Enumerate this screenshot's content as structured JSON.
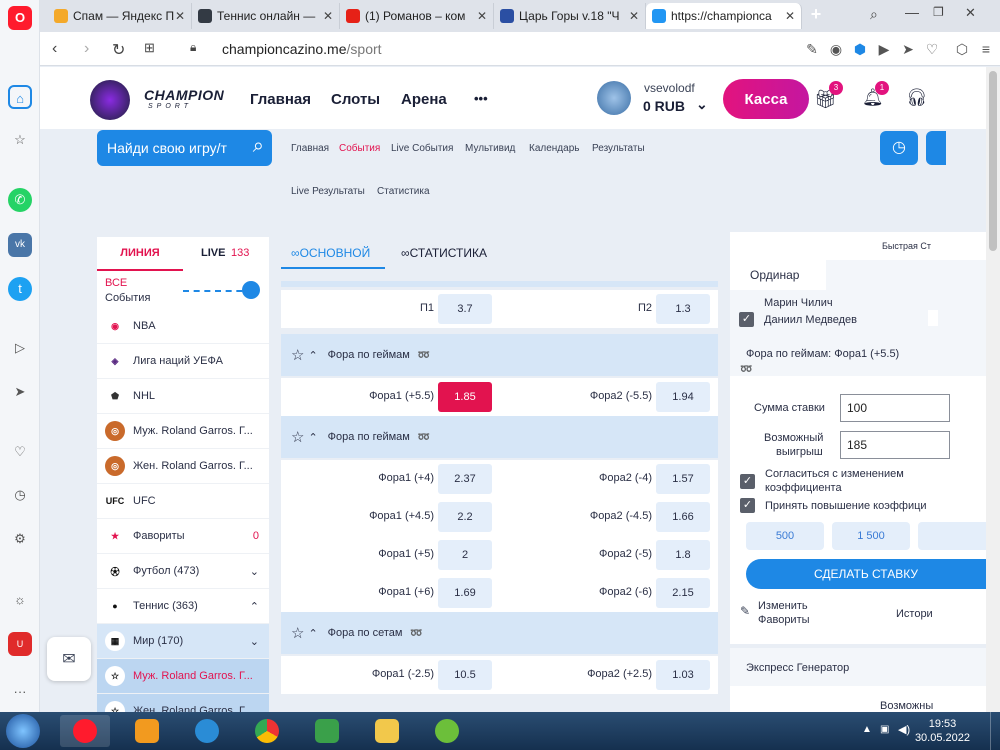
{
  "browser": {
    "tabs": [
      {
        "label": "Спам — Яндекс П",
        "color": "#f4a92a"
      },
      {
        "label": "Теннис онлайн —",
        "color": "#333a44"
      },
      {
        "label": "(1) Романов – ком",
        "color": "#e62117"
      },
      {
        "label": "Царь Горы v.18 \"Ч",
        "color": "#2b4fa3"
      },
      {
        "label": "https://championca",
        "color": "#2196f3"
      }
    ],
    "url_domain": "championcazino.me",
    "url_path": "/sport"
  },
  "header": {
    "logo_top": "CHAMPION",
    "logo_bottom": "SPORT",
    "nav": [
      "Главная",
      "Слоты",
      "Арена"
    ],
    "more_label": "•••",
    "username": "vsevolodf",
    "balance": "0 RUB",
    "kassa_label": "Касса",
    "gift_badge": "3",
    "bell_badge": "1"
  },
  "search": {
    "placeholder": "Найди свою игру/т"
  },
  "subnav": [
    "Главная",
    "События",
    "Live События",
    "Мультивид",
    "Календарь",
    "Результаты",
    "Live Результаты",
    "Статистика"
  ],
  "left": {
    "tab_line": "ЛИНИЯ",
    "tab_live": "LIVE",
    "live_count": "133",
    "all_label": "ВСЕ",
    "events_label": "События",
    "items": [
      {
        "label": "NBA",
        "right": ""
      },
      {
        "label": "Лига наций УЕФА",
        "right": ""
      },
      {
        "label": "NHL",
        "right": ""
      },
      {
        "label": "Муж. Roland Garros. Г...",
        "right": ""
      },
      {
        "label": "Жен. Roland Garros. Г...",
        "right": ""
      },
      {
        "label": "UFC",
        "right": ""
      },
      {
        "label": "Фавориты",
        "right": "0"
      },
      {
        "label": "Футбол (473)",
        "right": "⌄"
      },
      {
        "label": "Теннис (363)",
        "right": "⌃"
      },
      {
        "label": "Мир (170)",
        "right": "⌄"
      },
      {
        "label": "Муж. Roland Garros. Г...",
        "right": ""
      },
      {
        "label": "Жен. Roland Garros. Г...",
        "right": ""
      }
    ]
  },
  "center": {
    "tab_main": "ОСНОВНОЙ",
    "tab_stats": "СТАТИСТИКА",
    "rows": [
      {
        "type": "odds",
        "l1": "П1",
        "v1": "3.7",
        "l2": "П2",
        "v2": "1.3"
      },
      {
        "type": "head",
        "title": "Фора по геймам"
      },
      {
        "type": "odds",
        "l1": "Фора1 (+5.5)",
        "v1": "1.85",
        "l2": "Фора2 (-5.5)",
        "v2": "1.94",
        "sel": true
      },
      {
        "type": "head",
        "title": "Фора по геймам"
      },
      {
        "type": "odds",
        "l1": "Фора1 (+4)",
        "v1": "2.37",
        "l2": "Фора2 (-4)",
        "v2": "1.57"
      },
      {
        "type": "odds",
        "l1": "Фора1 (+4.5)",
        "v1": "2.2",
        "l2": "Фора2 (-4.5)",
        "v2": "1.66"
      },
      {
        "type": "odds",
        "l1": "Фора1 (+5)",
        "v1": "2",
        "l2": "Фора2 (-5)",
        "v2": "1.8"
      },
      {
        "type": "odds",
        "l1": "Фора1 (+6)",
        "v1": "1.69",
        "l2": "Фора2 (-6)",
        "v2": "2.15"
      },
      {
        "type": "head",
        "title": "Фора по сетам"
      },
      {
        "type": "odds",
        "l1": "Фора1 (-2.5)",
        "v1": "10.5",
        "l2": "Фора2 (+2.5)",
        "v2": "1.03"
      }
    ]
  },
  "betslip": {
    "quick_bet": "Быстрая Ст",
    "tab_single": "Ординар",
    "player1": "Марин Чилич",
    "player2": "Даниил Медведев",
    "market": "Фора по геймам: Фора1 (+5.5)",
    "stake_label": "Сумма ставки",
    "stake_value": "100",
    "win_label_1": "Возможный",
    "win_label_2": "выигрыш",
    "win_value": "185",
    "agree_label_1": "Согласиться с изменением",
    "agree_label_2": "коэффициента",
    "accept_label": "Принять повышение коэффици",
    "chips": [
      "500",
      "1 500"
    ],
    "make_bet": "СДЕЛАТЬ СТАВКУ",
    "change_label_1": "Изменить",
    "change_label_2": "Фавориты",
    "history_label": "Истори",
    "express": "Экспресс Генератор",
    "possible": "Возможны"
  },
  "taskbar": {
    "time": "19:53",
    "date": "30.05.2022"
  }
}
